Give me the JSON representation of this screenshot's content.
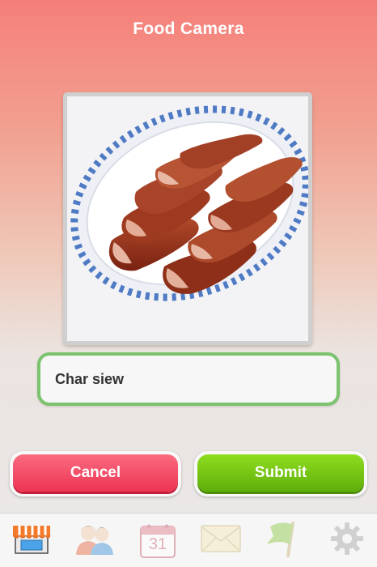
{
  "header": {
    "title": "Food Camera"
  },
  "photo": {
    "alt": "Char siew photo"
  },
  "food_input": {
    "value": "Char siew"
  },
  "actions": {
    "cancel_label": "Cancel",
    "submit_label": "Submit"
  },
  "tabbar": {
    "items": [
      {
        "icon": "store-icon",
        "active": true
      },
      {
        "icon": "friends-icon",
        "active": false
      },
      {
        "icon": "calendar-icon",
        "active": false,
        "day": "31"
      },
      {
        "icon": "mail-icon",
        "active": false
      },
      {
        "icon": "flag-icon",
        "active": false
      },
      {
        "icon": "gear-icon",
        "active": false
      }
    ]
  },
  "colors": {
    "header_top": "#f47f79",
    "input_border": "#7cc36f",
    "cancel": "#ec3453",
    "submit": "#6cbf0e"
  }
}
